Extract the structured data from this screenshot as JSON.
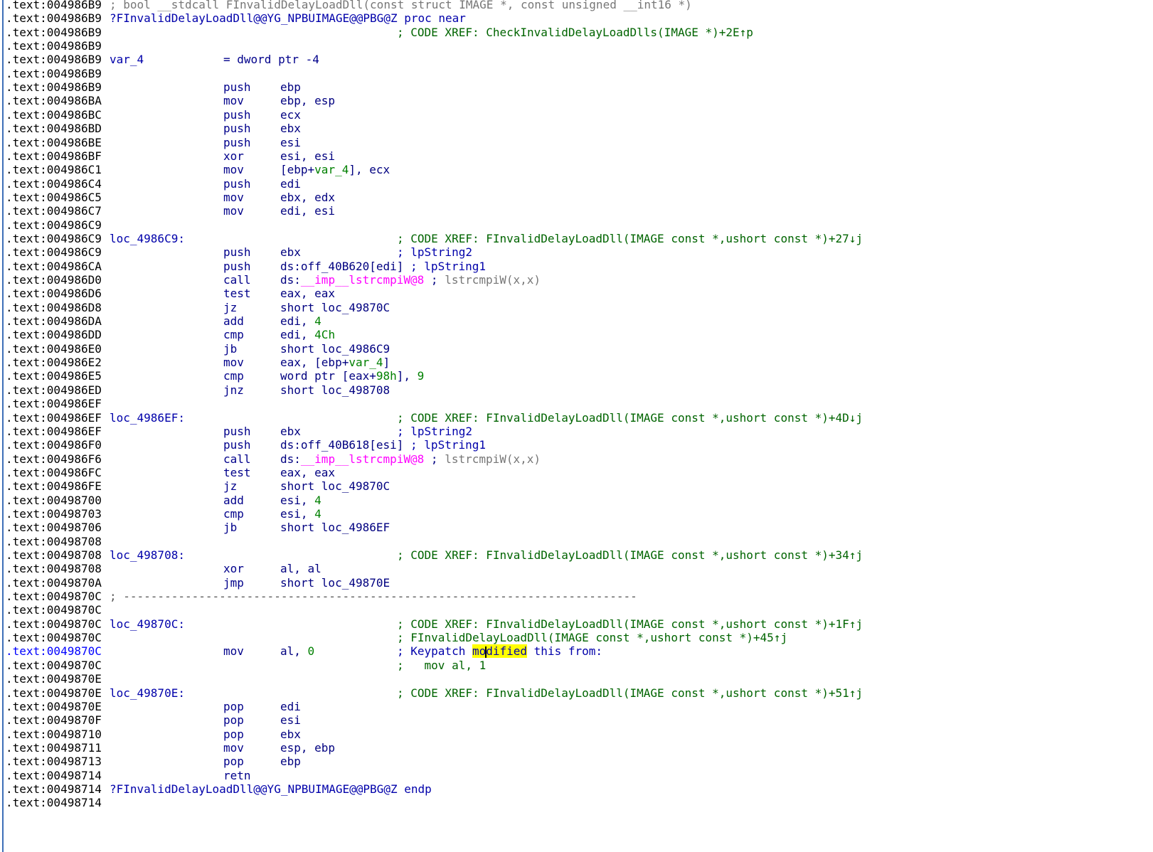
{
  "colors": {
    "address": "#000000",
    "label": "#0000aa",
    "instruction": "#00008b",
    "comment": "#006400",
    "import": "#ff00ff",
    "highlight": "#ffff00",
    "left_bar": "#3d6fb8"
  },
  "lines": [
    {
      "addr": ".text:004986B9",
      "hdr": "; bool __stdcall FInvalidDelayLoadDll(const struct IMAGE *, const unsigned __int16 *)"
    },
    {
      "addr": ".text:004986B9",
      "label": "?FInvalidDelayLoadDll@@YG_NPBUIMAGE@@PBG@Z proc near"
    },
    {
      "addr": ".text:004986B9",
      "cmt": "; CODE XREF: CheckInvalidDelayLoadDlls(IMAGE *)+2E↑p"
    },
    {
      "addr": ".text:004986B9"
    },
    {
      "addr": ".text:004986B9",
      "label": "var_4",
      "ops_seg": "= dword ptr -4"
    },
    {
      "addr": ".text:004986B9"
    },
    {
      "addr": ".text:004986B9",
      "mnem": "push",
      "ops": "ebp"
    },
    {
      "addr": ".text:004986BA",
      "mnem": "mov",
      "ops": "ebp, esp"
    },
    {
      "addr": ".text:004986BC",
      "mnem": "push",
      "ops": "ecx"
    },
    {
      "addr": ".text:004986BD",
      "mnem": "push",
      "ops": "ebx"
    },
    {
      "addr": ".text:004986BE",
      "mnem": "push",
      "ops": "esi"
    },
    {
      "addr": ".text:004986BF",
      "mnem": "xor",
      "ops": "esi, esi"
    },
    {
      "addr": ".text:004986C1",
      "mnem": "mov",
      "ops": "[ebp+var_4], ecx"
    },
    {
      "addr": ".text:004986C4",
      "mnem": "push",
      "ops": "edi"
    },
    {
      "addr": ".text:004986C5",
      "mnem": "mov",
      "ops": "ebx, edx"
    },
    {
      "addr": ".text:004986C7",
      "mnem": "mov",
      "ops": "edi, esi"
    },
    {
      "addr": ".text:004986C9"
    },
    {
      "addr": ".text:004986C9",
      "label": "loc_4986C9:",
      "cmt": "; CODE XREF: FInvalidDelayLoadDll(IMAGE const *,ushort const *)+27↓j"
    },
    {
      "addr": ".text:004986C9",
      "mnem": "push",
      "ops": "ebx",
      "cmt": "; lpString2"
    },
    {
      "addr": ".text:004986CA",
      "mnem": "push",
      "ops": "ds:off_40B620[edi] ; lpString1"
    },
    {
      "addr": ".text:004986D0",
      "mnem": "call",
      "ops": "ds:__imp__lstrcmpiW@8 ; lstrcmpiW(x,x)"
    },
    {
      "addr": ".text:004986D6",
      "mnem": "test",
      "ops": "eax, eax"
    },
    {
      "addr": ".text:004986D8",
      "mnem": "jz",
      "ops": "short loc_49870C"
    },
    {
      "addr": ".text:004986DA",
      "mnem": "add",
      "ops": "edi, 4"
    },
    {
      "addr": ".text:004986DD",
      "mnem": "cmp",
      "ops": "edi, 4Ch"
    },
    {
      "addr": ".text:004986E0",
      "mnem": "jb",
      "ops": "short loc_4986C9"
    },
    {
      "addr": ".text:004986E2",
      "mnem": "mov",
      "ops": "eax, [ebp+var_4]"
    },
    {
      "addr": ".text:004986E5",
      "mnem": "cmp",
      "ops": "word ptr [eax+98h], 9"
    },
    {
      "addr": ".text:004986ED",
      "mnem": "jnz",
      "ops": "short loc_498708"
    },
    {
      "addr": ".text:004986EF"
    },
    {
      "addr": ".text:004986EF",
      "label": "loc_4986EF:",
      "cmt": "; CODE XREF: FInvalidDelayLoadDll(IMAGE const *,ushort const *)+4D↓j"
    },
    {
      "addr": ".text:004986EF",
      "mnem": "push",
      "ops": "ebx",
      "cmt": "; lpString2"
    },
    {
      "addr": ".text:004986F0",
      "mnem": "push",
      "ops": "ds:off_40B618[esi] ; lpString1"
    },
    {
      "addr": ".text:004986F6",
      "mnem": "call",
      "ops": "ds:__imp__lstrcmpiW@8 ; lstrcmpiW(x,x)"
    },
    {
      "addr": ".text:004986FC",
      "mnem": "test",
      "ops": "eax, eax"
    },
    {
      "addr": ".text:004986FE",
      "mnem": "jz",
      "ops": "short loc_49870C"
    },
    {
      "addr": ".text:00498700",
      "mnem": "add",
      "ops": "esi, 4"
    },
    {
      "addr": ".text:00498703",
      "mnem": "cmp",
      "ops": "esi, 4"
    },
    {
      "addr": ".text:00498706",
      "mnem": "jb",
      "ops": "short loc_4986EF"
    },
    {
      "addr": ".text:00498708"
    },
    {
      "addr": ".text:00498708",
      "label": "loc_498708:",
      "cmt": "; CODE XREF: FInvalidDelayLoadDll(IMAGE const *,ushort const *)+34↑j"
    },
    {
      "addr": ".text:00498708",
      "mnem": "xor",
      "ops": "al, al"
    },
    {
      "addr": ".text:0049870A",
      "mnem": "jmp",
      "ops": "short loc_49870E"
    },
    {
      "addr": ".text:0049870C",
      "sep": "; ---------------------------------------------------------------------------"
    },
    {
      "addr": ".text:0049870C"
    },
    {
      "addr": ".text:0049870C",
      "label": "loc_49870C:",
      "cmt": "; CODE XREF: FInvalidDelayLoadDll(IMAGE const *,ushort const *)+1F↑j"
    },
    {
      "addr": ".text:0049870C",
      "cmt": "; FInvalidDelayLoadDll(IMAGE const *,ushort const *)+45↑j"
    },
    {
      "addr": ".text:0049870C",
      "mnem": "mov",
      "ops": "al, 0",
      "cmt_pre": "; Keypatch ",
      "cmt_hl": "modified",
      "cmt_post": " this from:",
      "current": true
    },
    {
      "addr": ".text:0049870C",
      "cmt": ";   mov al, 1"
    },
    {
      "addr": ".text:0049870E"
    },
    {
      "addr": ".text:0049870E",
      "label": "loc_49870E:",
      "cmt": "; CODE XREF: FInvalidDelayLoadDll(IMAGE const *,ushort const *)+51↑j"
    },
    {
      "addr": ".text:0049870E",
      "mnem": "pop",
      "ops": "edi"
    },
    {
      "addr": ".text:0049870F",
      "mnem": "pop",
      "ops": "esi"
    },
    {
      "addr": ".text:00498710",
      "mnem": "pop",
      "ops": "ebx"
    },
    {
      "addr": ".text:00498711",
      "mnem": "mov",
      "ops": "esp, ebp"
    },
    {
      "addr": ".text:00498713",
      "mnem": "pop",
      "ops": "ebp"
    },
    {
      "addr": ".text:00498714",
      "mnem": "retn"
    },
    {
      "addr": ".text:00498714",
      "label": "?FInvalidDelayLoadDll@@YG_NPBUIMAGE@@PBG@Z endp"
    },
    {
      "addr": ".text:00498714"
    }
  ]
}
